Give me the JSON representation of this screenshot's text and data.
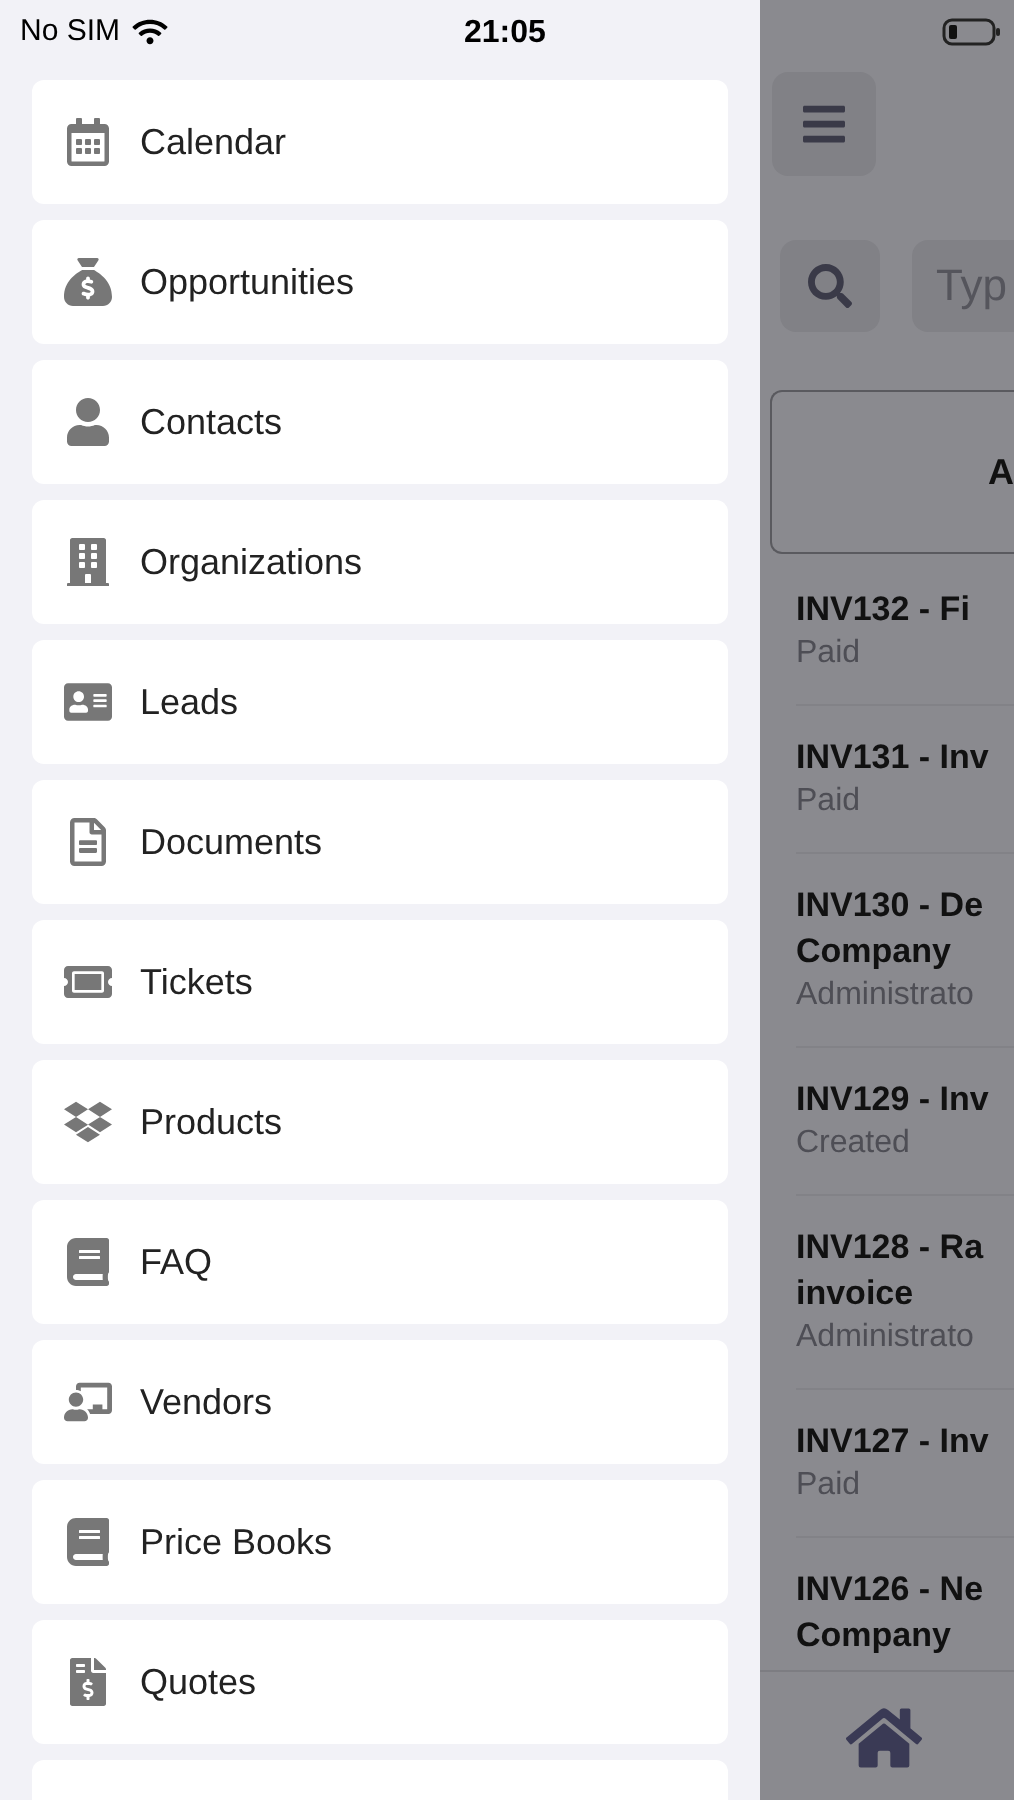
{
  "status_bar": {
    "carrier": "No SIM",
    "time": "21:05"
  },
  "menu": [
    {
      "label": "Calendar"
    },
    {
      "label": "Opportunities"
    },
    {
      "label": "Contacts"
    },
    {
      "label": "Organizations"
    },
    {
      "label": "Leads"
    },
    {
      "label": "Documents"
    },
    {
      "label": "Tickets"
    },
    {
      "label": "Products"
    },
    {
      "label": "FAQ"
    },
    {
      "label": "Vendors"
    },
    {
      "label": "Price Books"
    },
    {
      "label": "Quotes"
    }
  ],
  "background": {
    "search_placeholder": "Typ",
    "header": "A",
    "rows": [
      {
        "title": [
          "INV132 - Fi"
        ],
        "subtitle": "Paid"
      },
      {
        "title": [
          "INV131 - Inv"
        ],
        "subtitle": "Paid"
      },
      {
        "title": [
          "INV130 - De",
          "Company"
        ],
        "subtitle": "Administrato"
      },
      {
        "title": [
          "INV129 - Inv"
        ],
        "subtitle": "Created"
      },
      {
        "title": [
          "INV128 - Ra",
          "invoice"
        ],
        "subtitle": "Administrato"
      },
      {
        "title": [
          "INV127 - Inv"
        ],
        "subtitle": "Paid"
      },
      {
        "title": [
          "INV126 - Ne",
          "Company"
        ]
      }
    ]
  }
}
